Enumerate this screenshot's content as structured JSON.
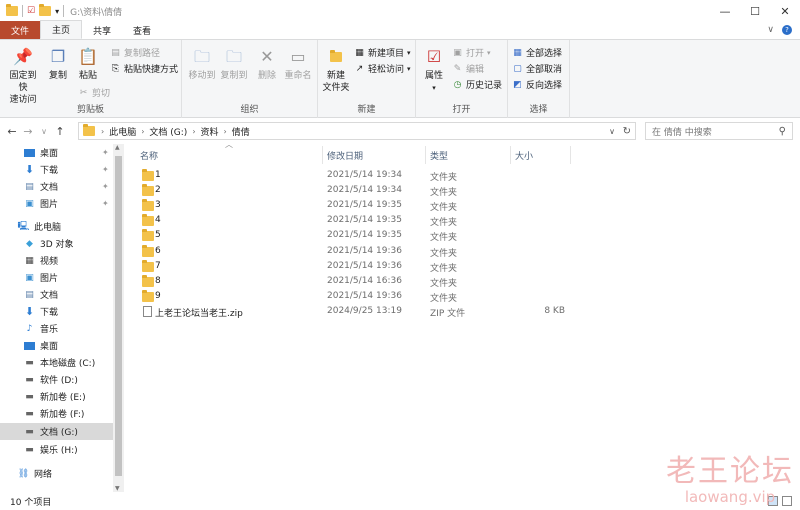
{
  "window": {
    "title": "G:\\资料\\倩倩",
    "controls": {
      "minimize": "—",
      "maximize": "☐",
      "close": "✕"
    }
  },
  "tabs": [
    {
      "label": "文件"
    },
    {
      "label": "主页"
    },
    {
      "label": "共享"
    },
    {
      "label": "查看"
    }
  ],
  "ribbon": {
    "clipboard": {
      "group_label": "剪贴板",
      "pin_label_1": "固定到快",
      "pin_label_2": "速访问",
      "copy": "复制",
      "paste": "粘贴",
      "copy_path": "复制路径",
      "paste_shortcut": "粘贴快捷方式",
      "cut": "剪切"
    },
    "organize": {
      "group_label": "组织",
      "move_to": "移动到",
      "copy_to": "复制到",
      "delete": "删除",
      "rename": "重命名"
    },
    "new": {
      "group_label": "新建",
      "new_folder_1": "新建",
      "new_folder_2": "文件夹",
      "new_item": "新建项目",
      "easy_access": "轻松访问"
    },
    "open": {
      "group_label": "打开",
      "properties": "属性",
      "open": "打开",
      "edit": "编辑",
      "history": "历史记录"
    },
    "select": {
      "group_label": "选择",
      "select_all": "全部选择",
      "select_none": "全部取消",
      "invert": "反向选择"
    }
  },
  "address": {
    "crumbs": [
      "此电脑",
      "文档 (G:)",
      "资料",
      "倩倩"
    ],
    "search_placeholder": "在 倩倩 中搜索"
  },
  "nav": {
    "quick": [
      {
        "label": "桌面",
        "icon": "desktop-icon",
        "pinned": true
      },
      {
        "label": "下载",
        "icon": "download-icon",
        "pinned": true
      },
      {
        "label": "文档",
        "icon": "documents-icon",
        "pinned": true
      },
      {
        "label": "图片",
        "icon": "pictures-icon",
        "pinned": true
      }
    ],
    "this_pc": "此电脑",
    "pc_items": [
      {
        "label": "3D 对象",
        "icon": "3d-objects-icon"
      },
      {
        "label": "视频",
        "icon": "videos-icon"
      },
      {
        "label": "图片",
        "icon": "pictures-icon"
      },
      {
        "label": "文档",
        "icon": "documents-icon"
      },
      {
        "label": "下载",
        "icon": "download-icon"
      },
      {
        "label": "音乐",
        "icon": "music-icon"
      },
      {
        "label": "桌面",
        "icon": "desktop-icon"
      },
      {
        "label": "本地磁盘 (C:)",
        "icon": "drive-icon"
      },
      {
        "label": "软件 (D:)",
        "icon": "drive-icon"
      },
      {
        "label": "新加卷 (E:)",
        "icon": "drive-icon"
      },
      {
        "label": "新加卷 (F:)",
        "icon": "drive-icon"
      },
      {
        "label": "文档 (G:)",
        "icon": "drive-icon",
        "selected": true
      },
      {
        "label": "娱乐 (H:)",
        "icon": "drive-icon"
      }
    ],
    "network": "网络"
  },
  "columns": {
    "name": "名称",
    "date": "修改日期",
    "type": "类型",
    "size": "大小"
  },
  "files": [
    {
      "name": "1",
      "date": "2021/5/14 19:34",
      "type": "文件夹",
      "size": "",
      "kind": "folder"
    },
    {
      "name": "2",
      "date": "2021/5/14 19:34",
      "type": "文件夹",
      "size": "",
      "kind": "folder"
    },
    {
      "name": "3",
      "date": "2021/5/14 19:35",
      "type": "文件夹",
      "size": "",
      "kind": "folder"
    },
    {
      "name": "4",
      "date": "2021/5/14 19:35",
      "type": "文件夹",
      "size": "",
      "kind": "folder"
    },
    {
      "name": "5",
      "date": "2021/5/14 19:35",
      "type": "文件夹",
      "size": "",
      "kind": "folder"
    },
    {
      "name": "6",
      "date": "2021/5/14 19:36",
      "type": "文件夹",
      "size": "",
      "kind": "folder"
    },
    {
      "name": "7",
      "date": "2021/5/14 19:36",
      "type": "文件夹",
      "size": "",
      "kind": "folder"
    },
    {
      "name": "8",
      "date": "2021/5/14 16:36",
      "type": "文件夹",
      "size": "",
      "kind": "folder"
    },
    {
      "name": "9",
      "date": "2021/5/14 19:36",
      "type": "文件夹",
      "size": "",
      "kind": "folder"
    },
    {
      "name": "上老王论坛当老王.zip",
      "date": "2024/9/25 13:19",
      "type": "ZIP 文件",
      "size": "8 KB",
      "kind": "zip"
    }
  ],
  "status": {
    "count": "10 个项目"
  },
  "watermark": {
    "line1": "老王论坛",
    "line2": "laowang.vip"
  }
}
